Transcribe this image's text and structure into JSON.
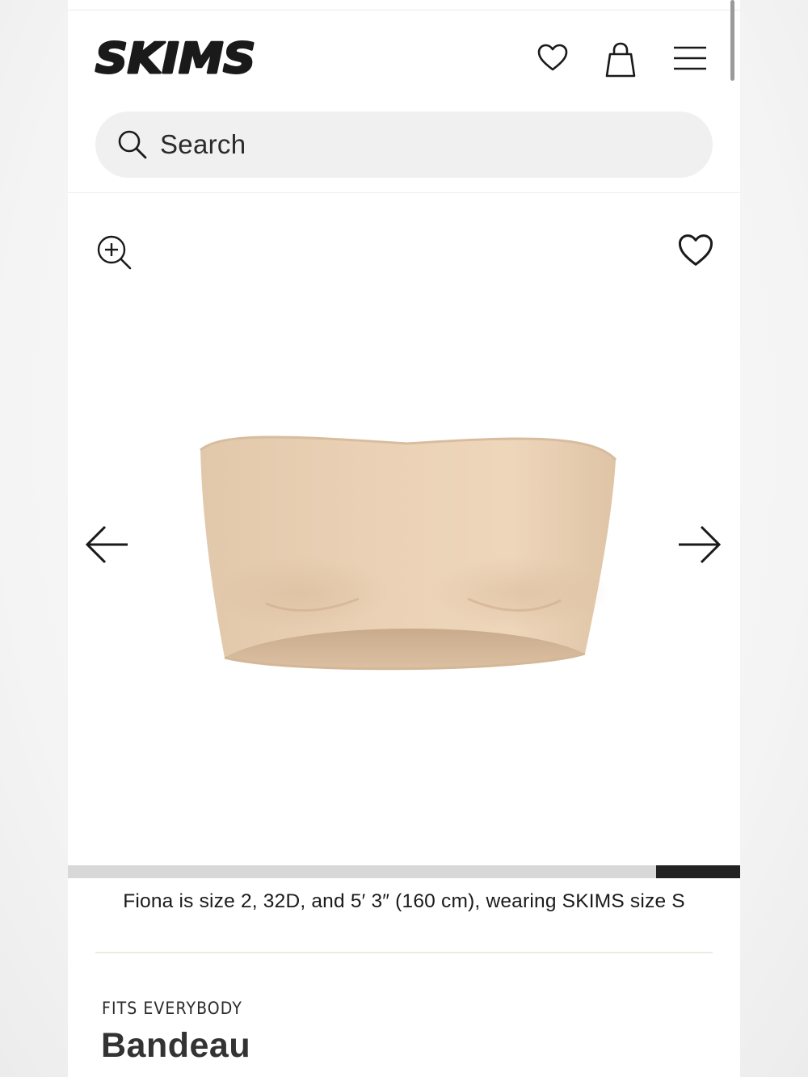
{
  "header": {
    "brand": "SKIMS",
    "icons": [
      "heart-icon",
      "shopping-bag-icon",
      "menu-icon"
    ]
  },
  "search": {
    "placeholder": "Search",
    "icon": "search-icon"
  },
  "gallery": {
    "icons": [
      "zoom-in-icon",
      "heart-icon",
      "arrow-left-icon",
      "arrow-right-icon"
    ],
    "image": "nude strapless bandeau top",
    "progress": {
      "start": 0.875,
      "end": 1.0
    }
  },
  "product": {
    "fit_note": "Fiona is size 2, 32D, and 5′ 3″ (160 cm), wearing SKIMS size S",
    "collection": "FITS EVERYBODY",
    "name": "Bandeau"
  },
  "colors": {
    "product": "#e6cfb3",
    "progress_track": "#d8d8d8",
    "progress_fill": "#222222",
    "search_bg": "#f0f0f0"
  }
}
